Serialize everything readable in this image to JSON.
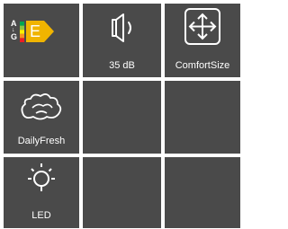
{
  "energy_label": {
    "scale_top": "A",
    "scale_bottom": "G",
    "class": "E",
    "arrow_color": "#f0b400",
    "scale_colors": [
      "#00a651",
      "#8dc63f",
      "#fff200",
      "#f7941d",
      "#ed1c24"
    ]
  },
  "features": [
    {
      "label": "",
      "icon": "energy-label-icon"
    },
    {
      "label": "35 dB",
      "icon": "speaker-icon"
    },
    {
      "label": "ComfortSize",
      "icon": "resize-arrows-icon"
    },
    {
      "label": "DailyFresh",
      "icon": "lettuce-icon"
    },
    {
      "label": "",
      "icon": ""
    },
    {
      "label": "",
      "icon": ""
    },
    {
      "label": "LED",
      "icon": "light-bulb-icon"
    },
    {
      "label": "",
      "icon": ""
    },
    {
      "label": "",
      "icon": ""
    }
  ],
  "colors": {
    "tile": "#4a4a4a",
    "icon": "#ffffff"
  }
}
